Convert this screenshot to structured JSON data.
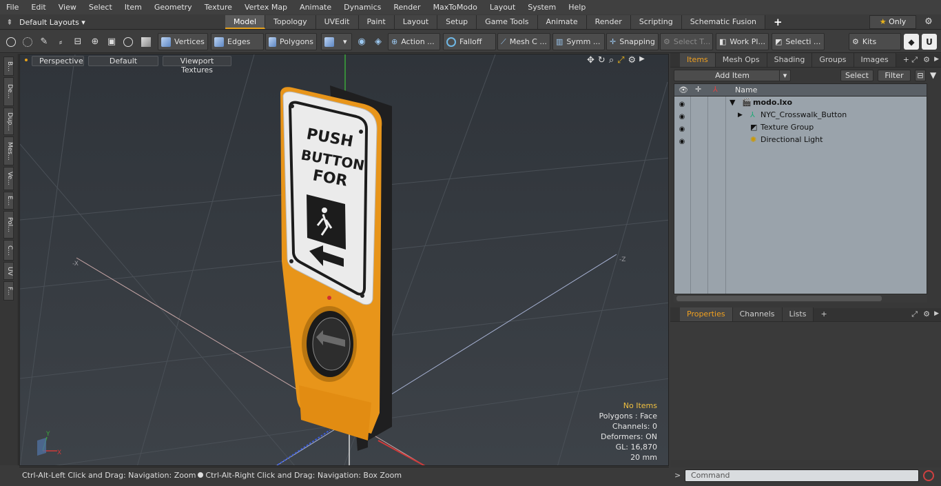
{
  "menu": [
    "File",
    "Edit",
    "View",
    "Select",
    "Item",
    "Geometry",
    "Texture",
    "Vertex Map",
    "Animate",
    "Dynamics",
    "Render",
    "MaxToModo",
    "Layout",
    "System",
    "Help"
  ],
  "layouts": {
    "label": "Default Layouts ▾"
  },
  "layout_tabs": [
    "Model",
    "Topology",
    "UVEdit",
    "Paint",
    "Layout",
    "Setup",
    "Game Tools",
    "Animate",
    "Render",
    "Scripting",
    "Schematic Fusion"
  ],
  "layout_tabs_add": "+",
  "only_button": {
    "star": "★",
    "label": "Only"
  },
  "toolbar": {
    "vertices": "Vertices",
    "edges": "Edges",
    "polygons": "Polygons",
    "action": "Action ...",
    "falloff": "Falloff",
    "mesh": "Mesh C ...",
    "symmetry": "Symm ...",
    "snapping": "Snapping",
    "select_t": "Select T...",
    "work_plane": "Work Pl...",
    "selection": "Selecti ...",
    "kits": "Kits"
  },
  "left_tabs": [
    "B...",
    "De...",
    "Dup...",
    "Mes...",
    "Ve...",
    "E...",
    "Pol...",
    "C...",
    "UV",
    "F..."
  ],
  "viewport": {
    "perspective": "Perspective",
    "default": "Default",
    "viewport_textures": "Viewport Textures",
    "sign_line1": "PUSH",
    "sign_line2": "BUTTON",
    "sign_line3": "FOR",
    "axis_y": "Y",
    "axis_x": "X",
    "axis_neg_x": "-X",
    "axis_neg_z": "-Z"
  },
  "stats": {
    "no_items": "No Items",
    "polygons": "Polygons : Face",
    "channels": "Channels: 0",
    "deformers": "Deformers: ON",
    "gl": "GL: 16,870",
    "scale": "20 mm"
  },
  "status": {
    "left": "Ctrl-Alt-Left Click and Drag: Navigation: Zoom",
    "right": "Ctrl-Alt-Right Click and Drag: Navigation: Box Zoom"
  },
  "items_panel": {
    "tabs": [
      "Items",
      "Mesh Ops",
      "Shading",
      "Groups",
      "Images"
    ],
    "add_tab": "+",
    "add_item": "Add Item",
    "select": "Select",
    "filter": "Filter",
    "column_name": "Name",
    "tree": [
      {
        "label": "modo.lxo",
        "bold": true
      },
      {
        "label": "NYC_Crosswalk_Button"
      },
      {
        "label": "Texture Group"
      },
      {
        "label": "Directional Light"
      }
    ]
  },
  "properties_panel": {
    "tabs": [
      "Properties",
      "Channels",
      "Lists"
    ],
    "add_tab": "+"
  },
  "command": {
    "placeholder": "Command",
    "prompt": ">"
  },
  "colors": {
    "accent": "#e8a21b",
    "sign_yellow": "#e89a12",
    "tree_bg": "#9aa3ab"
  }
}
